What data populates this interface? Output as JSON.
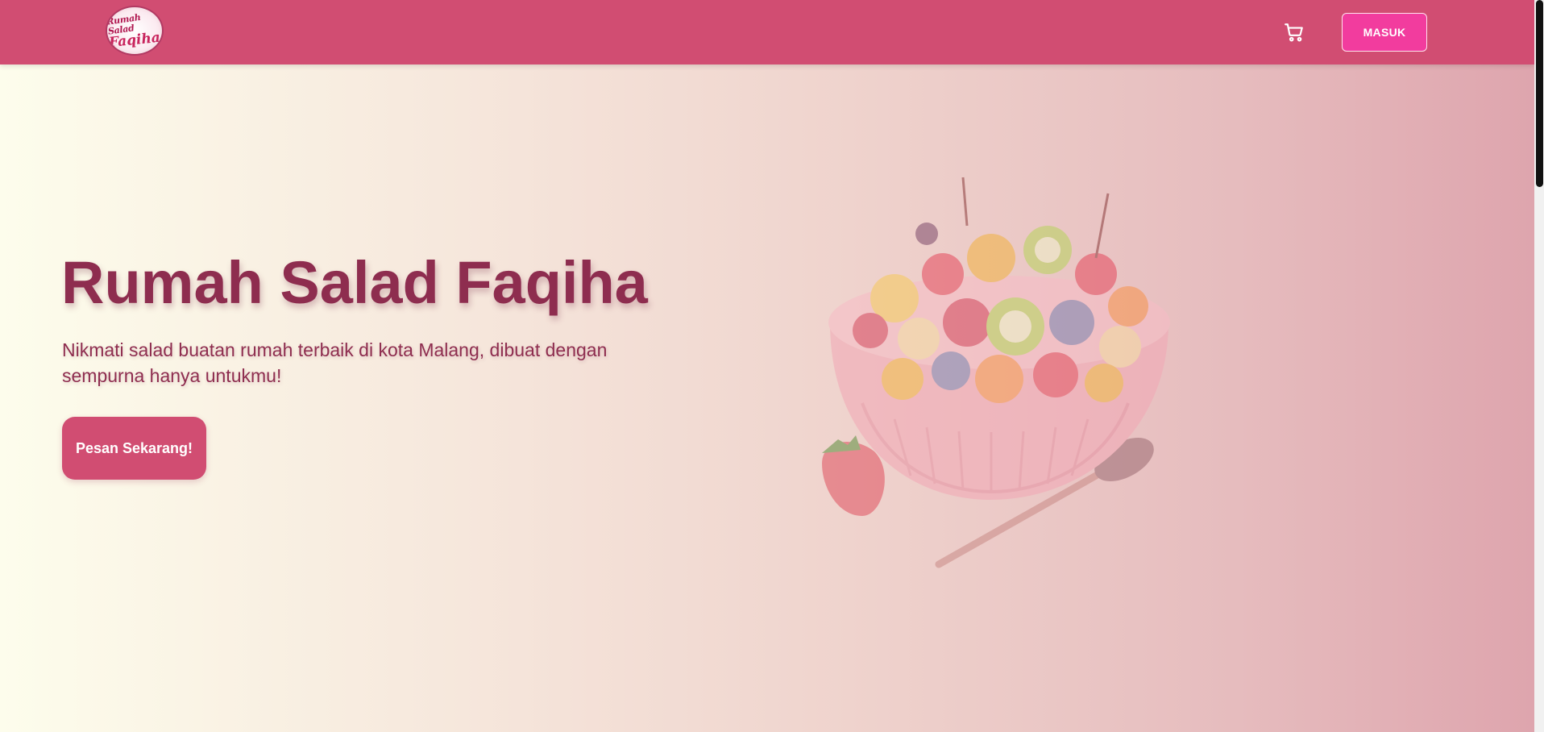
{
  "brand": {
    "logo_line1": "Rumah Salad",
    "logo_line2": "Faqiha",
    "logo_icon": "logo-badge"
  },
  "navbar": {
    "cart_icon": "shopping-cart-icon",
    "login_label": "MASUK"
  },
  "hero": {
    "title": "Rumah Salad Faqiha",
    "subtitle": "Nikmati salad buatan rumah terbaik di kota Malang, dibuat dengan sempurna hanya untukmu!",
    "cta_label": "Pesan Sekarang!",
    "image_icon": "fruit-salad-bowl-image"
  },
  "colors": {
    "navbar": "#d14d72",
    "login_button": "#f23c9e",
    "heading": "#8e2d4f",
    "cta": "#d14d72"
  }
}
